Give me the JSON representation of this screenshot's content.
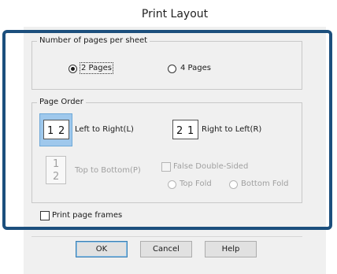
{
  "dialog": {
    "title": "Print Layout"
  },
  "pages_per_sheet": {
    "label": "Number of pages per sheet",
    "options": [
      {
        "label": "2 Pages",
        "selected": true
      },
      {
        "label": "4 Pages",
        "selected": false
      }
    ]
  },
  "page_order": {
    "label": "Page Order",
    "left_to_right": {
      "label": "Left to Right(L)",
      "digits": [
        "1",
        "2"
      ],
      "selected": true
    },
    "right_to_left": {
      "label": "Right to Left(R)",
      "digits": [
        "2",
        "1"
      ],
      "selected": false
    },
    "top_to_bottom": {
      "label": "Top to Bottom(P)",
      "digits": [
        "1",
        "2"
      ],
      "enabled": false
    },
    "false_double_sided": {
      "label": "False Double-Sided",
      "enabled": false,
      "checked": false
    },
    "fold_options": [
      {
        "label": "Top Fold",
        "enabled": false
      },
      {
        "label": "Bottom Fold",
        "enabled": false
      }
    ]
  },
  "print_page_frames": {
    "label": "Print page frames",
    "checked": false
  },
  "buttons": {
    "ok": "OK",
    "cancel": "Cancel",
    "help": "Help"
  },
  "colors": {
    "highlight": "#1c4f7d",
    "selected_order": "#9fc8ec",
    "default_button": "#3c7fb1"
  }
}
